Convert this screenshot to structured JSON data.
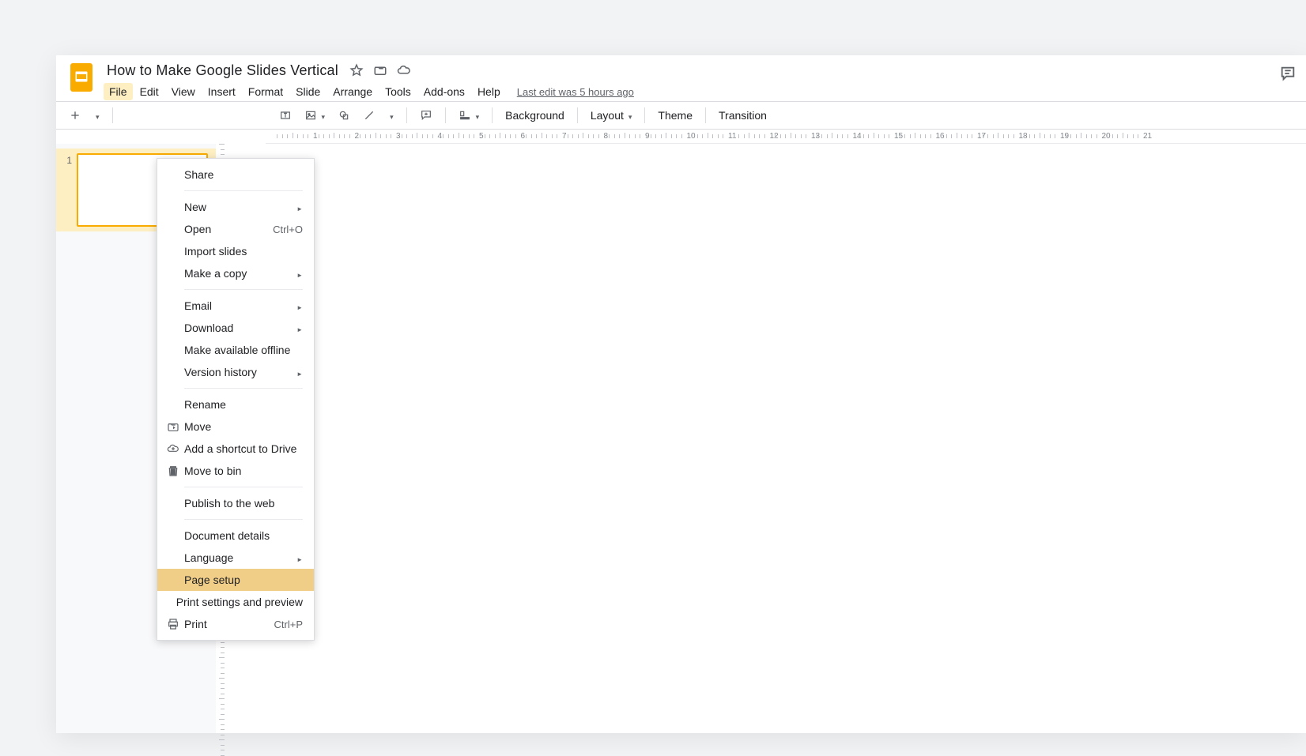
{
  "doc": {
    "title": "How to Make Google Slides Vertical",
    "last_edit": "Last edit was 5 hours ago"
  },
  "menubar": [
    "File",
    "Edit",
    "View",
    "Insert",
    "Format",
    "Slide",
    "Arrange",
    "Tools",
    "Add-ons",
    "Help"
  ],
  "toolbar": {
    "background": "Background",
    "layout": "Layout",
    "theme": "Theme",
    "transition": "Transition"
  },
  "slide_number": "1",
  "ruler_numbers": [
    "1",
    "2",
    "3",
    "4",
    "5",
    "6",
    "7",
    "8",
    "9",
    "10",
    "11",
    "12",
    "13",
    "14",
    "15",
    "16",
    "17",
    "18",
    "19",
    "20",
    "21"
  ],
  "dropdown": {
    "groups": [
      [
        {
          "label": "Share"
        }
      ],
      [
        {
          "label": "New",
          "submenu": true
        },
        {
          "label": "Open",
          "shortcut": "Ctrl+O"
        },
        {
          "label": "Import slides"
        },
        {
          "label": "Make a copy",
          "submenu": true
        }
      ],
      [
        {
          "label": "Email",
          "submenu": true
        },
        {
          "label": "Download",
          "submenu": true
        },
        {
          "label": "Make available offline"
        },
        {
          "label": "Version history",
          "submenu": true
        }
      ],
      [
        {
          "label": "Rename"
        },
        {
          "label": "Move",
          "icon": "move"
        },
        {
          "label": "Add a shortcut to Drive",
          "icon": "shortcut"
        },
        {
          "label": "Move to bin",
          "icon": "trash"
        }
      ],
      [
        {
          "label": "Publish to the web"
        }
      ],
      [
        {
          "label": "Document details"
        },
        {
          "label": "Language",
          "submenu": true
        },
        {
          "label": "Page setup",
          "highlight": true
        },
        {
          "label": "Print settings and preview"
        },
        {
          "label": "Print",
          "icon": "print",
          "shortcut": "Ctrl+P"
        }
      ]
    ]
  }
}
